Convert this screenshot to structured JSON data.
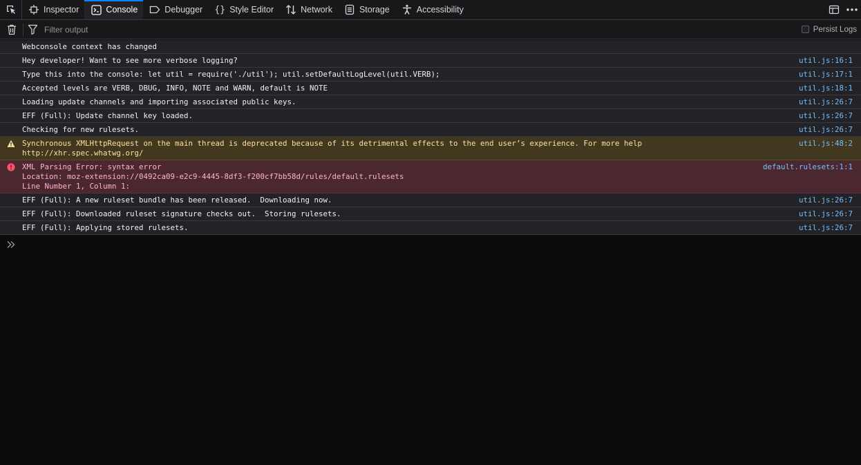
{
  "toolbar": {
    "tabs": [
      {
        "label": "Inspector",
        "icon": "inspector-icon",
        "selected": false
      },
      {
        "label": "Console",
        "icon": "console-icon",
        "selected": true
      },
      {
        "label": "Debugger",
        "icon": "debugger-icon",
        "selected": false
      },
      {
        "label": "Style Editor",
        "icon": "style-editor-icon",
        "selected": false
      },
      {
        "label": "Network",
        "icon": "network-icon",
        "selected": false
      },
      {
        "label": "Storage",
        "icon": "storage-icon",
        "selected": false
      },
      {
        "label": "Accessibility",
        "icon": "accessibility-icon",
        "selected": false
      }
    ]
  },
  "filterbar": {
    "placeholder": "Filter output",
    "persist_label": "Persist Logs"
  },
  "messages": [
    {
      "level": "log",
      "lines": [
        "Webconsole context has changed"
      ],
      "location": ""
    },
    {
      "level": "log",
      "lines": [
        "Hey developer! Want to see more verbose logging?"
      ],
      "location": "util.js:16:1"
    },
    {
      "level": "log",
      "lines": [
        "Type this into the console: let util = require('./util'); util.setDefaultLogLevel(util.VERB);"
      ],
      "location": "util.js:17:1"
    },
    {
      "level": "log",
      "lines": [
        "Accepted levels are VERB, DBUG, INFO, NOTE and WARN, default is NOTE"
      ],
      "location": "util.js:18:1"
    },
    {
      "level": "log",
      "lines": [
        "Loading update channels and importing associated public keys."
      ],
      "location": "util.js:26:7"
    },
    {
      "level": "log",
      "lines": [
        "EFF (Full): Update channel key loaded."
      ],
      "location": "util.js:26:7"
    },
    {
      "level": "log",
      "lines": [
        "Checking for new rulesets."
      ],
      "location": "util.js:26:7"
    },
    {
      "level": "warn",
      "lines": [
        "Synchronous XMLHttpRequest on the main thread is deprecated because of its detrimental effects to the end user’s experience. For more help",
        "http://xhr.spec.whatwg.org/"
      ],
      "location": "util.js:48:2"
    },
    {
      "level": "error",
      "lines": [
        "XML Parsing Error: syntax error",
        "Location: moz-extension://0492ca09-e2c9-4445-8df3-f200cf7bb58d/rules/default.rulesets",
        "Line Number 1, Column 1:"
      ],
      "location": "default.rulesets:1:1"
    },
    {
      "level": "log",
      "lines": [
        "EFF (Full): A new ruleset bundle has been released.  Downloading now."
      ],
      "location": "util.js:26:7"
    },
    {
      "level": "log",
      "lines": [
        "EFF (Full): Downloaded ruleset signature checks out.  Storing rulesets."
      ],
      "location": "util.js:26:7"
    },
    {
      "level": "log",
      "lines": [
        "EFF (Full): Applying stored rulesets."
      ],
      "location": "util.js:26:7"
    }
  ],
  "colors": {
    "accent": "#0a84ff",
    "warning": "#fce19f",
    "error": "#ff4f6f",
    "location_link": "#75bfff"
  }
}
